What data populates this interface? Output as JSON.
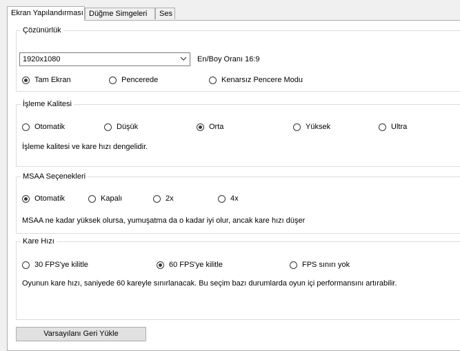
{
  "tabs": [
    {
      "label": "Ekran Yapılandırması"
    },
    {
      "label": "Düğme Simgeleri"
    },
    {
      "label": "Ses"
    }
  ],
  "resolution": {
    "legend": "Çözünürlük",
    "selected": "1920x1080",
    "aspect": "En/Boy Oranı 16:9",
    "modes": [
      "Tam Ekran",
      "Pencerede",
      "Kenarsız Pencere Modu"
    ],
    "selected_mode": "Tam Ekran"
  },
  "quality": {
    "legend": "İşleme Kalitesi",
    "options": [
      "Otomatik",
      "Düşük",
      "Orta",
      "Yüksek",
      "Ultra"
    ],
    "selected": "Orta",
    "description": "İşleme kalitesi ve kare hızı dengelidir."
  },
  "msaa": {
    "legend": "MSAA Seçenekleri",
    "options": [
      "Otomatik",
      "Kapalı",
      "2x",
      "4x"
    ],
    "selected": "Otomatik",
    "description": "MSAA ne kadar yüksek olursa, yumuşatma da o kadar iyi olur, ancak kare hızı düşer"
  },
  "framerate": {
    "legend": "Kare Hızı",
    "options": [
      "30 FPS'ye kilitle",
      "60 FPS'ye kilitle",
      "FPS sınırı yok"
    ],
    "selected": "60 FPS'ye kilitle",
    "description": "Oyunun kare hızı, saniyede 60 kareyle sınırlanacak. Bu seçim bazı durumlarda oyun içi performansını artırabilir."
  },
  "defaults_button": "Varsayılanı Geri Yükle"
}
